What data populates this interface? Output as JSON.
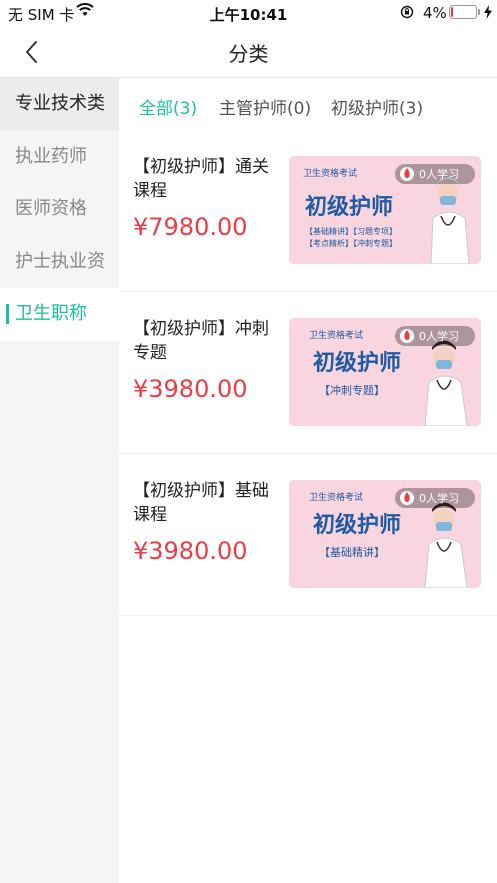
{
  "status_bar": {
    "carrier": "无 SIM 卡",
    "time": "上午10:41",
    "battery_percent": "4%",
    "battery_level": 0.04
  },
  "nav": {
    "title": "分类"
  },
  "sidebar": {
    "items": [
      {
        "label": "专业技术类"
      },
      {
        "label": "执业药师"
      },
      {
        "label": "医师资格"
      },
      {
        "label": "护士执业资"
      },
      {
        "label": "卫生职称"
      }
    ]
  },
  "tabs": [
    {
      "label": "全部(3)"
    },
    {
      "label": "主管护师(0)"
    },
    {
      "label": "初级护师(3)"
    }
  ],
  "courses": [
    {
      "title": "【初级护师】通关课程",
      "price": "¥7980.00",
      "thumb": {
        "exam": "卫生资格考试",
        "heading": "初级护师",
        "learners": "0人学习",
        "tags": [
          "【基础精讲】【习题专项】",
          "【考点精析】【冲刺专题】"
        ]
      }
    },
    {
      "title": "【初级护师】冲刺专题",
      "price": "¥3980.00",
      "thumb": {
        "exam": "卫生资格考试",
        "heading": "初级护师",
        "learners": "0人学习",
        "tags": [
          "【冲刺专题】"
        ]
      }
    },
    {
      "title": "【初级护师】基础课程",
      "price": "¥3980.00",
      "thumb": {
        "exam": "卫生资格考试",
        "heading": "初级护师",
        "learners": "0人学习",
        "tags": [
          "【基础精讲】"
        ]
      }
    }
  ],
  "colors": {
    "accent": "#1cbf9d",
    "price": "#ef3b46",
    "thumb_bg": "#f9d6df",
    "thumb_heading": "#1f5aa6"
  }
}
